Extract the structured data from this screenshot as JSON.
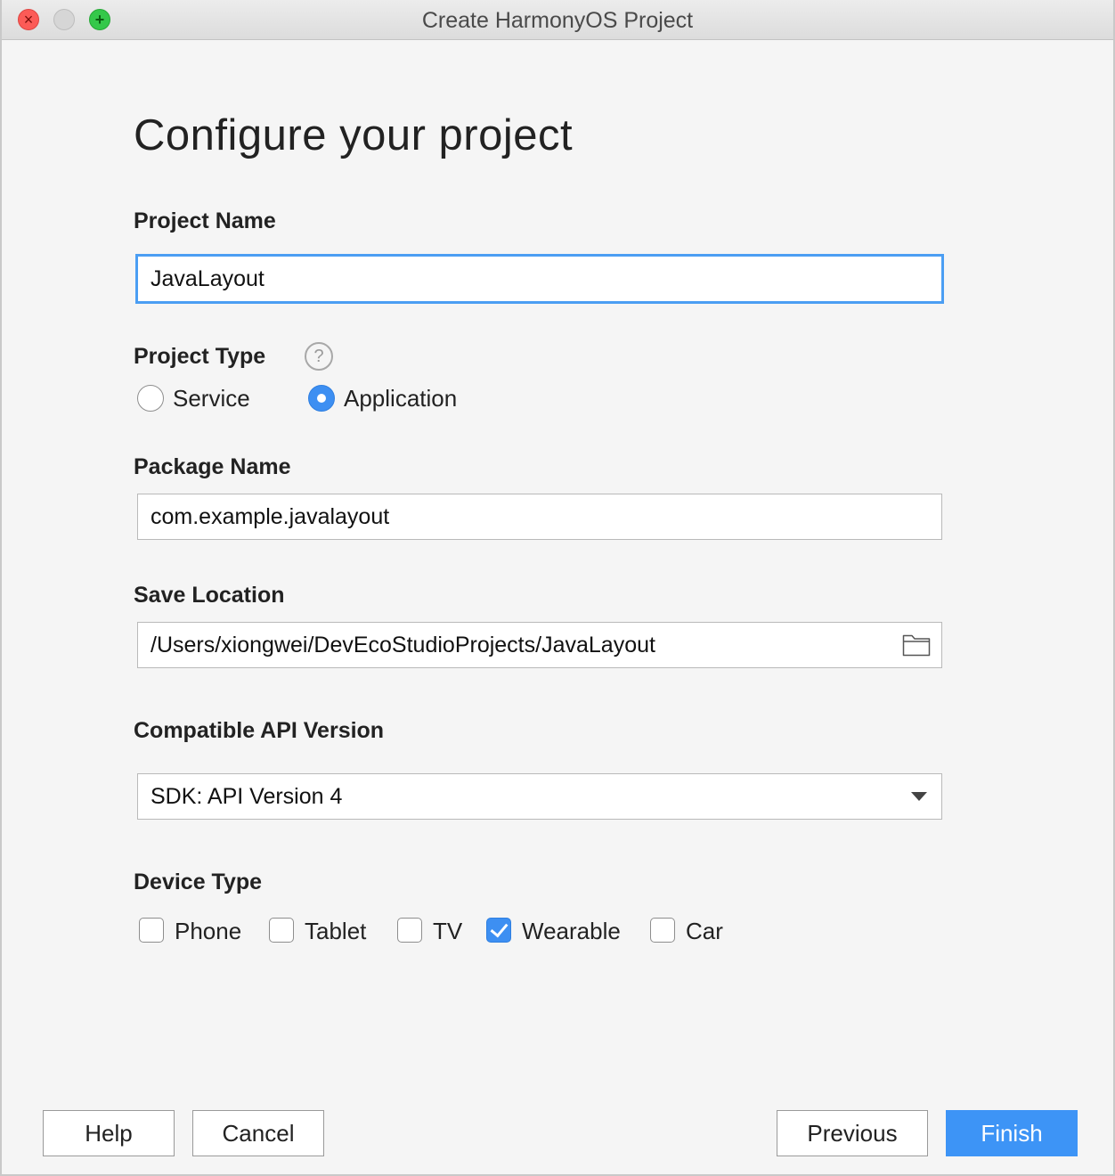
{
  "window": {
    "title": "Create HarmonyOS Project"
  },
  "heading": "Configure your project",
  "project_name": {
    "label": "Project Name",
    "value": "JavaLayout"
  },
  "project_type": {
    "label": "Project Type",
    "help_glyph": "?",
    "options": [
      {
        "label": "Service",
        "selected": false
      },
      {
        "label": "Application",
        "selected": true
      }
    ]
  },
  "package_name": {
    "label": "Package Name",
    "value": "com.example.javalayout"
  },
  "save_location": {
    "label": "Save Location",
    "value": "/Users/xiongwei/DevEcoStudioProjects/JavaLayout",
    "icon": "folder-icon"
  },
  "api_version": {
    "label": "Compatible API Version",
    "selected": "SDK: API Version 4"
  },
  "device_type": {
    "label": "Device Type",
    "options": [
      {
        "label": "Phone",
        "checked": false
      },
      {
        "label": "Tablet",
        "checked": false
      },
      {
        "label": "TV",
        "checked": false
      },
      {
        "label": "Wearable",
        "checked": true
      },
      {
        "label": "Car",
        "checked": false
      }
    ]
  },
  "buttons": {
    "help": "Help",
    "cancel": "Cancel",
    "previous": "Previous",
    "finish": "Finish"
  },
  "colors": {
    "accent": "#3d94f6",
    "focus_border": "#4b9ef3",
    "close": "#fc5b57",
    "maximize": "#34c84a"
  }
}
